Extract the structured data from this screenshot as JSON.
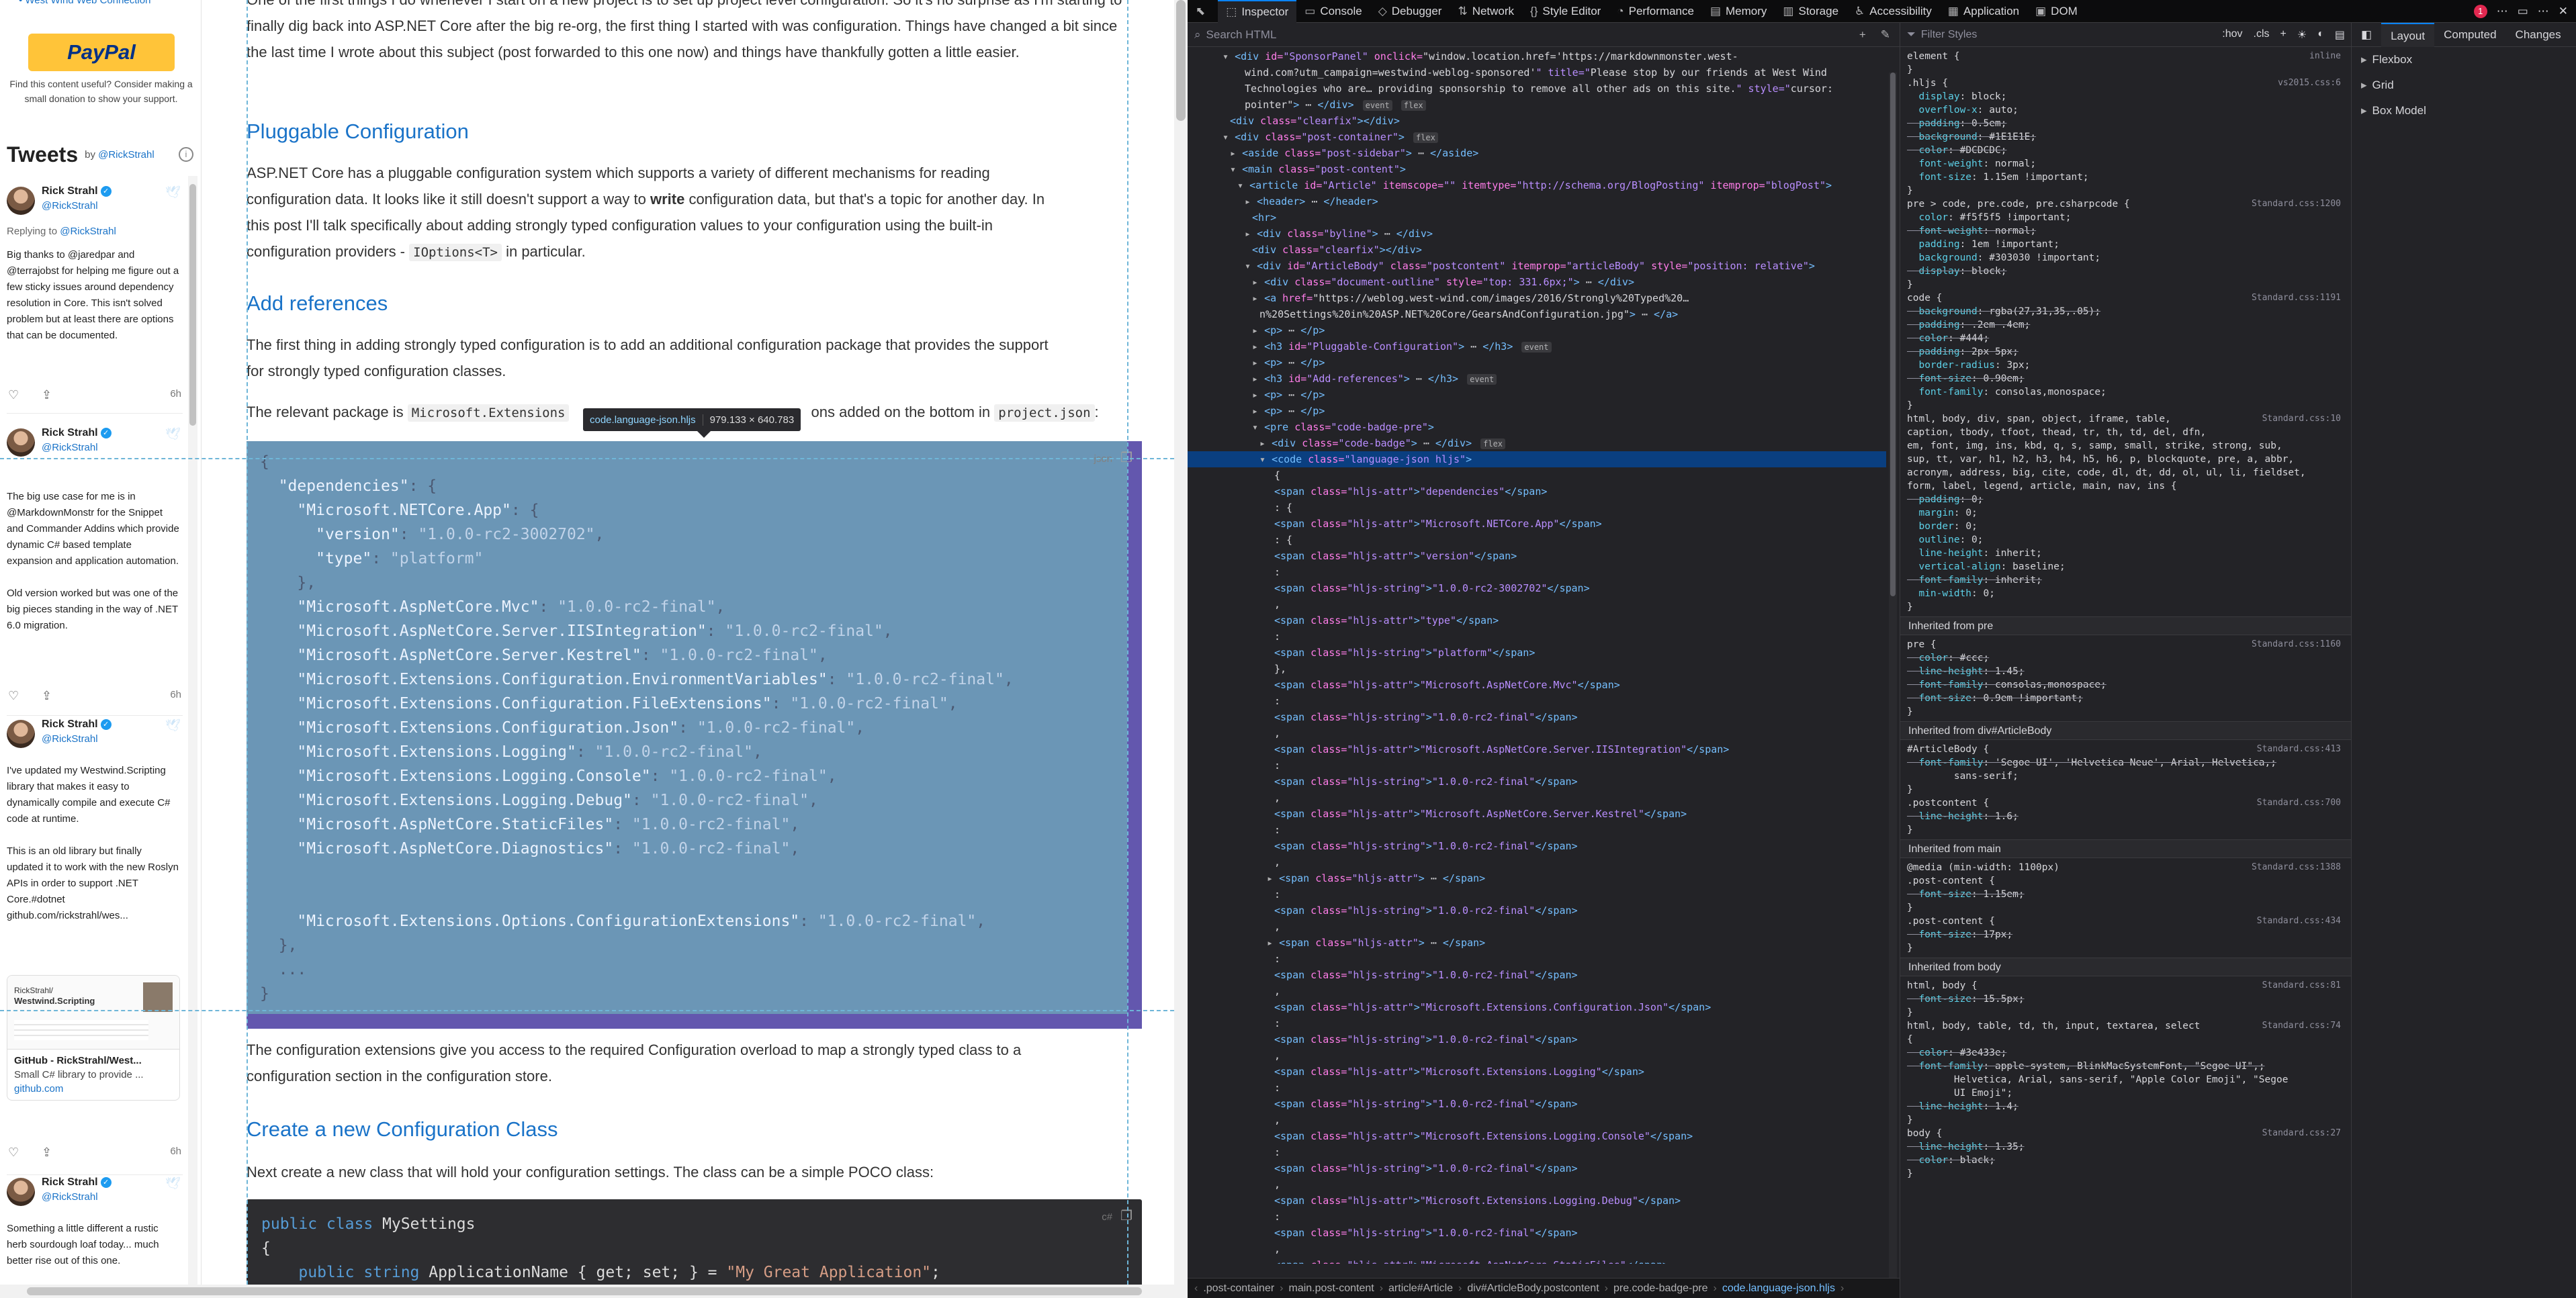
{
  "sidebar": {
    "paypal_link": "West Wind Web Connection",
    "paypal_label": "PayPal",
    "paypal_desc": "Find this content useful? Consider making a small donation to show your support.",
    "tweets_title": "Tweets",
    "tweets_by": "by",
    "tweets_handle": "@RickStrahl",
    "tweets": [
      {
        "name": "Rick Strahl",
        "handle": "@RickStrahl",
        "reply_label": "Replying to",
        "reply_to": "@RickStrahl",
        "text": "Big thanks to @jaredpar and @terrajobst for helping me figure out a few sticky issues around dependency resolution in Core. This isn't solved problem but at least there are options that can be documented.",
        "time": "6h"
      },
      {
        "name": "Rick Strahl",
        "handle": "@RickStrahl",
        "text": "The big use case for me is in @MarkdownMonstr for the Snippet and Commander Addins which provide dynamic C# based template expansion and application automation.\n\nOld version worked but was one of the big pieces standing in the way of .NET 6.0 migration.",
        "time": "6h"
      },
      {
        "name": "Rick Strahl",
        "handle": "@RickStrahl",
        "text": "I've updated my Westwind.Scripting library that makes it easy to dynamically compile and execute C# code at runtime.\n\nThis is an old library but finally updated it to work with the new Roslyn APIs in order to support .NET Core.#dotnet\ngithub.com/rickstrahl/wes...",
        "card_img_title": "RickStrahl/",
        "card_img_subtitle": "Westwind.Scripting",
        "card_title": "GitHub - RickStrahl/West...",
        "card_desc": "Small C# library to provide ...",
        "card_domain": "github.com",
        "time": "6h"
      },
      {
        "name": "Rick Strahl",
        "handle": "@RickStrahl",
        "text": "Something a little different a rustic herb sourdough loaf today... much better rise out of this one."
      }
    ]
  },
  "article": {
    "intro": "One of the first things I do whenever I start on a new project is to set up project level configuration. So it's no surprise as I'm starting to finally dig back into ASP.NET Core after the big re-org, the first thing I started with was configuration. Things have changed a bit since the last time I wrote about this subject (post forwarded to this one now) and things have thankfully gotten a little easier.",
    "h_pluggable": "Pluggable Configuration",
    "p_pluggable": [
      "ASP.NET Core has a pluggable configuration system which supports a variety of different mechanisms for reading",
      "configuration data. It looks like it still doesn't support a way to ",
      "write",
      " configuration data, but that's a topic for another day. In",
      "this post I'll talk specifically about adding strongly typed configuration values to your configuration using the built-in",
      "configuration providers - ",
      "IOptions<T>",
      " in particular."
    ],
    "h_add_refs": "Add references",
    "p_add_refs": [
      "The first thing in adding strongly typed configuration is to add an additional configuration package that provides the support",
      "for strongly typed configuration classes."
    ],
    "p_relevant": [
      "The relevant package is ",
      "Microsoft.Extensions",
      "ons",
      " added on the bottom in ",
      "project.json",
      ":"
    ],
    "json_lines": [
      "{",
      "  \"dependencies\": {",
      "    \"Microsoft.NETCore.App\": {",
      "      \"version\": \"1.0.0-rc2-3002702\",",
      "      \"type\": \"platform\"",
      "    },",
      "    \"Microsoft.AspNetCore.Mvc\": \"1.0.0-rc2-final\",",
      "    \"Microsoft.AspNetCore.Server.IISIntegration\": \"1.0.0-rc2-final\",",
      "    \"Microsoft.AspNetCore.Server.Kestrel\": \"1.0.0-rc2-final\",",
      "    \"Microsoft.Extensions.Configuration.EnvironmentVariables\": \"1.0.0-rc2-final\",",
      "    \"Microsoft.Extensions.Configuration.FileExtensions\": \"1.0.0-rc2-final\",",
      "    \"Microsoft.Extensions.Configuration.Json\": \"1.0.0-rc2-final\",",
      "    \"Microsoft.Extensions.Logging\": \"1.0.0-rc2-final\",",
      "    \"Microsoft.Extensions.Logging.Console\": \"1.0.0-rc2-final\",",
      "    \"Microsoft.Extensions.Logging.Debug\": \"1.0.0-rc2-final\",",
      "    \"Microsoft.AspNetCore.StaticFiles\": \"1.0.0-rc2-final\",",
      "    \"Microsoft.AspNetCore.Diagnostics\": \"1.0.0-rc2-final\",",
      "",
      "",
      "    \"Microsoft.Extensions.Options.ConfigurationExtensions\": \"1.0.0-rc2-final\",",
      "  },",
      "  ...",
      "}"
    ],
    "json_lang_badge": "json",
    "tooltip_name": "code.language-json.hljs",
    "tooltip_size": "979.133 × 640.783",
    "p_extensions": [
      "The configuration extensions give you access to the required Configuration overload to map a strongly typed class to a",
      "configuration section in the configuration store."
    ],
    "h_create": "Create a new Configuration Class",
    "p_create": "Next create a new class that will hold your configuration settings. The class can be a simple POCO class:",
    "cs_lang_badge": "c#",
    "cs_lines": [
      [
        "public class",
        " MySettings"
      ],
      [
        "",
        "{"
      ],
      [
        "    public string",
        " ApplicationName { get; set; } = ",
        "\"My Great Application\"",
        ";"
      ]
    ]
  },
  "devtools": {
    "tabs": [
      {
        "icon": "⬚",
        "label": "Inspector"
      },
      {
        "icon": "▭",
        "label": "Console"
      },
      {
        "icon": "◇",
        "label": "Debugger"
      },
      {
        "icon": "⇅",
        "label": "Network"
      },
      {
        "icon": "{}",
        "label": "Style Editor"
      },
      {
        "icon": "◔",
        "label": "Performance"
      },
      {
        "icon": "▤",
        "label": "Memory"
      },
      {
        "icon": "▥",
        "label": "Storage"
      },
      {
        "icon": "♿",
        "label": "Accessibility"
      },
      {
        "icon": "▦",
        "label": "Application"
      },
      {
        "icon": "▣",
        "label": "DOM"
      }
    ],
    "error_count": "1",
    "search_placeholder": "Search HTML",
    "filter_placeholder": "Filter Styles",
    "hov": ":hov",
    "cls": ".cls",
    "layout_tabs": [
      "Layout",
      "Computed",
      "Changes"
    ],
    "layout_sections": [
      "Flexbox",
      "Grid",
      "Box Model"
    ],
    "breadcrumbs": [
      ".post-container",
      "main.post-content",
      "article#Article",
      "div#ArticleBody.postcontent",
      "pre.code-badge-pre",
      "code.language-json.hljs"
    ]
  }
}
